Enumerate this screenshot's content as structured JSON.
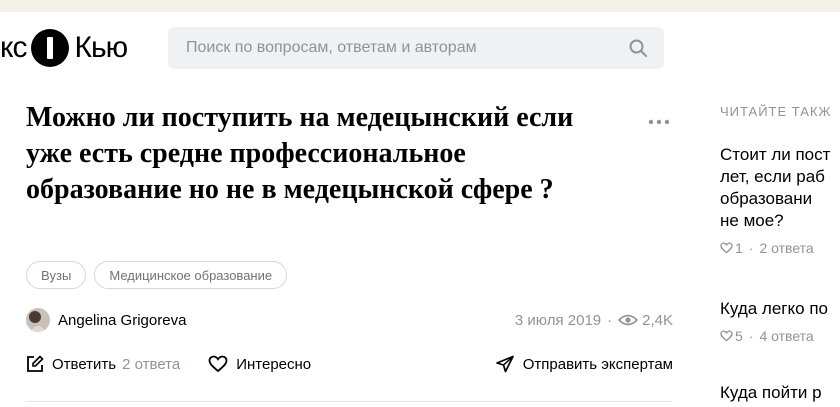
{
  "header": {
    "logo_left": "кс",
    "logo_right": "Кью",
    "search_placeholder": "Поиск по вопросам, ответам и авторам"
  },
  "question": {
    "title": "Можно ли поступить на медецынский если уже есть средне профессиональное образование но не в медецынской сфере ?",
    "tags": [
      "Вузы",
      "Медицинское образование"
    ],
    "author": "Angelina Grigoreva",
    "date": "3 июля 2019",
    "views": "2,4K"
  },
  "actions": {
    "answer_label": "Ответить",
    "answer_count": "2 ответа",
    "interesting_label": "Интересно",
    "send_label": "Отправить экспертам"
  },
  "sidebar": {
    "heading": "ЧИТАЙТЕ ТАКЖ",
    "items": [
      {
        "lines": [
          "Стоит ли пост",
          "лет, если раб",
          "образовани",
          "не мое?"
        ],
        "likes": "1",
        "answers": "2 ответа"
      },
      {
        "lines": [
          "Куда легко по"
        ],
        "likes": "5",
        "answers": "4 ответа"
      },
      {
        "lines": [
          "Куда пойти р"
        ]
      }
    ]
  },
  "colors": {
    "text": "#000000",
    "muted": "#8f9399",
    "search_bg": "#f0f1f3",
    "top_strip": "#f4f1e9",
    "border": "#d5d7db"
  }
}
